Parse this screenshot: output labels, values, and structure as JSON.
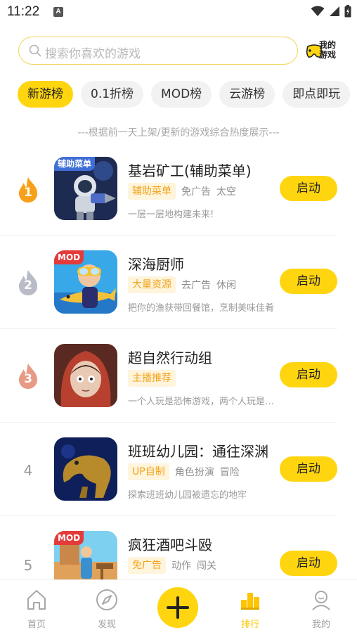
{
  "status_bar": {
    "time": "11:22",
    "notification_letter": "A"
  },
  "search": {
    "placeholder": "搜索你喜欢的游戏",
    "my_games_label": "我的游戏"
  },
  "tabs": [
    {
      "label": "新游榜",
      "active": true
    },
    {
      "label": "0.1折榜",
      "active": false
    },
    {
      "label": "MOD榜",
      "active": false
    },
    {
      "label": "云游榜",
      "active": false
    },
    {
      "label": "即点即玩",
      "active": false
    }
  ],
  "list_subtitle": "---根据前一天上架/更新的游戏综合热度展示---",
  "games": [
    {
      "rank": "1",
      "badge": "辅助菜单",
      "title": "基岩矿工(辅助菜单)",
      "tag_main": "辅助菜单",
      "tags": [
        "免广告",
        "太空"
      ],
      "desc": "一层一层地构建未来!",
      "button": "启动"
    },
    {
      "rank": "2",
      "badge": "MOD",
      "title": "深海厨师",
      "tag_main": "大量资源",
      "tags": [
        "去广告",
        "休闲"
      ],
      "desc": "把你的渔获带回餐馆，烹制美味佳肴",
      "button": "启动"
    },
    {
      "rank": "3",
      "badge": "",
      "title": "超自然行动组",
      "tag_main": "主播推荐",
      "tags": [],
      "desc": "一个人玩是恐怖游戏，两个人玩是喜剧",
      "button": "启动"
    },
    {
      "rank": "4",
      "badge": "",
      "title": "班班幼儿园：通往深渊",
      "tag_main": "UP自制",
      "tags": [
        "角色扮演",
        "冒险"
      ],
      "desc": "探索班班幼儿园被遗忘的地牢",
      "button": "启动"
    },
    {
      "rank": "5",
      "badge": "MOD",
      "title": "疯狂酒吧斗殴",
      "tag_main": "免广告",
      "tags": [
        "动作",
        "闯关"
      ],
      "desc": "",
      "button": "启动"
    }
  ],
  "bottom_nav": {
    "home": "首页",
    "discover": "发现",
    "ranking": "排行",
    "mine": "我的"
  },
  "colors": {
    "accent": "#ffd50f",
    "tag_text": "#f2a41b",
    "tag_bg": "#fff4dc",
    "rank1": "#f7a11a",
    "rank2": "#b9bcc6",
    "rank3": "#e89a86"
  }
}
